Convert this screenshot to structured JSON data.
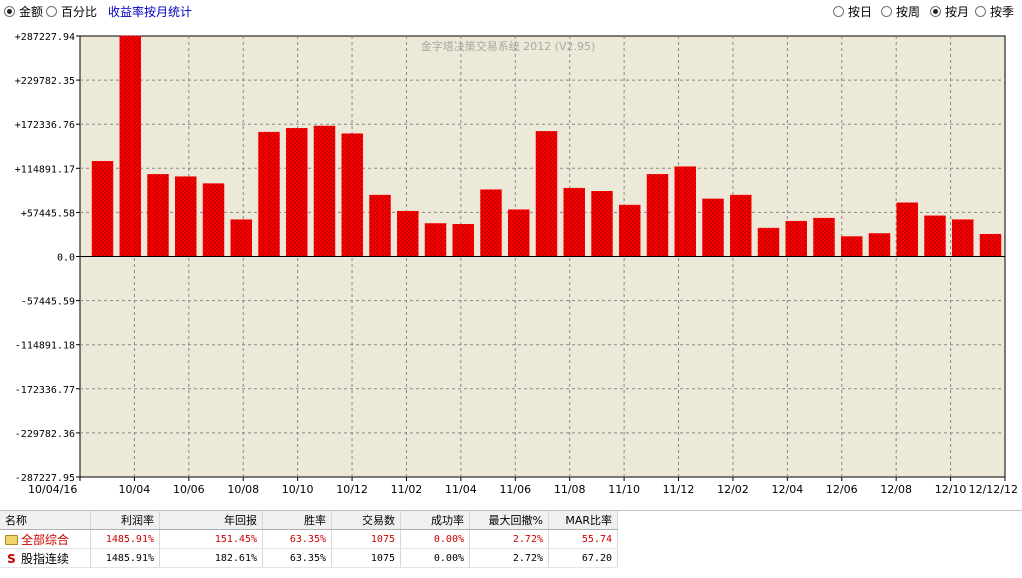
{
  "controls": {
    "mode_options": [
      {
        "label": "金额",
        "selected": true
      },
      {
        "label": "百分比",
        "selected": false
      }
    ],
    "stats_link": "收益率按月统计",
    "period_options": [
      {
        "label": "按日",
        "selected": false
      },
      {
        "label": "按周",
        "selected": false
      },
      {
        "label": "按月",
        "selected": true
      },
      {
        "label": "按季",
        "selected": false
      }
    ]
  },
  "chart_data": {
    "type": "bar",
    "watermark": "金字塔决策交易系统 2012 (V2.95)",
    "grid": true,
    "bar_color": "#ff0000",
    "plot_background": "#ece9d8",
    "ylim": [
      -287227.95,
      287227.94
    ],
    "yticks": [
      "+287227.94",
      "+229782.35",
      "+172336.76",
      "+114891.17",
      "+57445.58",
      "0.0",
      "-57445.59",
      "-114891.18",
      "-172336.77",
      "-229782.36",
      "-287227.95"
    ],
    "xticks": [
      "10/04/16",
      "10/04",
      "10/06",
      "10/08",
      "10/10",
      "10/12",
      "11/02",
      "11/04",
      "11/06",
      "11/08",
      "11/10",
      "11/12",
      "12/02",
      "12/04",
      "12/06",
      "12/08",
      "12/10",
      "12/12/12"
    ],
    "categories": [
      "10/04",
      "10/05",
      "10/06",
      "10/07",
      "10/08",
      "10/09",
      "10/10",
      "10/11",
      "10/12",
      "11/01",
      "11/02",
      "11/03",
      "11/04",
      "11/05",
      "11/06",
      "11/07",
      "11/08",
      "11/09",
      "11/10",
      "11/11",
      "11/12",
      "12/01",
      "12/02",
      "12/03",
      "12/04",
      "12/05",
      "12/06",
      "12/07",
      "12/08",
      "12/09",
      "12/10",
      "12/11",
      "12/12"
    ],
    "values": [
      124000,
      287227,
      107000,
      104000,
      95000,
      48000,
      162000,
      167000,
      170000,
      160000,
      80000,
      59000,
      43000,
      42000,
      87000,
      61000,
      163000,
      89000,
      85000,
      67000,
      107000,
      117000,
      75000,
      80000,
      37000,
      46000,
      50000,
      26000,
      30000,
      70000,
      53000,
      48000,
      29000
    ]
  },
  "table": {
    "columns": [
      "名称",
      "利润率",
      "年回报",
      "胜率",
      "交易数",
      "成功率",
      "最大回撤%",
      "MAR比率"
    ],
    "rows": [
      {
        "name": "全部综合",
        "icon": "folder-icon",
        "color": "#cc0000",
        "cells": [
          "1485.91%",
          "151.45%",
          "63.35%",
          "1075",
          "0.00%",
          "2.72%",
          "55.74"
        ]
      },
      {
        "name": "股指连续",
        "icon": "s-icon",
        "color": "#000000",
        "cells": [
          "1485.91%",
          "182.61%",
          "63.35%",
          "1075",
          "0.00%",
          "2.72%",
          "67.20"
        ]
      }
    ]
  }
}
